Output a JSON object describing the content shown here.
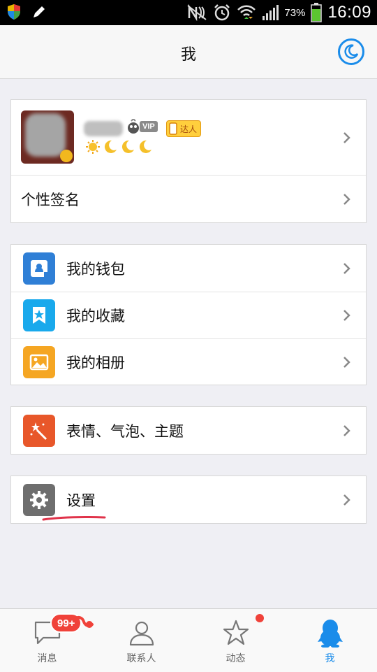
{
  "status_bar": {
    "battery_percent": "73%",
    "time": "16:09"
  },
  "nav": {
    "title": "我",
    "night_mode_icon": "moon-icon"
  },
  "profile": {
    "vip_label": "VIP",
    "talent_label": "达人",
    "level_icons": [
      "sun-icon",
      "moon-icon",
      "moon-icon",
      "moon-icon"
    ],
    "signature_label": "个性签名"
  },
  "menu_group_1": [
    {
      "label": "我的钱包",
      "icon": "wallet-icon",
      "color": "#2f7fd6"
    },
    {
      "label": "我的收藏",
      "icon": "favorites-star-icon",
      "color": "#19a9ec"
    },
    {
      "label": "我的相册",
      "icon": "photo-album-icon",
      "color": "#f5a623"
    }
  ],
  "menu_group_2": [
    {
      "label": "表情、气泡、主题",
      "icon": "magic-wand-icon",
      "color": "#e8572a"
    }
  ],
  "menu_group_3": [
    {
      "label": "设置",
      "icon": "gear-icon",
      "color": "#6e6e6e"
    }
  ],
  "tabs": [
    {
      "label": "消息",
      "icon": "chat-bubble-icon",
      "badge": "99+"
    },
    {
      "label": "联系人",
      "icon": "contacts-person-icon"
    },
    {
      "label": "动态",
      "icon": "star-icon"
    },
    {
      "label": "我",
      "icon": "qq-penguin-icon",
      "active": true
    }
  ],
  "colors": {
    "accent": "#1a8cea",
    "badge_red": "#f0423a"
  }
}
